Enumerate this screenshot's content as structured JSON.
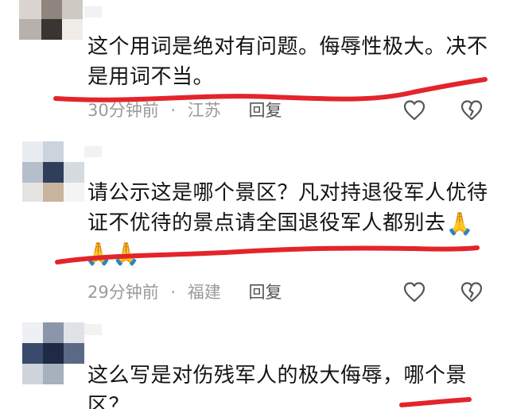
{
  "comments": [
    {
      "text_line1": "这个用词是绝对有问题。侮辱性极大。决不",
      "text_line2": "是用词不当。",
      "time": "30分钟前",
      "separator": "·",
      "location": "江苏",
      "reply_label": "回复"
    },
    {
      "text_line1": "请公示这是哪个景区？凡对持退役军人优待",
      "text_line2": "证不优待的景点请全国退役军人都别去",
      "emoji_inline": "🙏",
      "emoji_line3": "🙏🙏",
      "time": "29分钟前",
      "separator": "·",
      "location": "福建",
      "reply_label": "回复"
    },
    {
      "text_line1": "这么写是对伤残军人的极大侮辱，哪个景",
      "text_line2": "区？"
    }
  ],
  "icons": {
    "like": "heart-outline-icon",
    "dislike": "broken-heart-icon"
  },
  "colors": {
    "underline": "#e3242b",
    "meta_text": "#9a9a9a",
    "body_text": "#141414"
  }
}
